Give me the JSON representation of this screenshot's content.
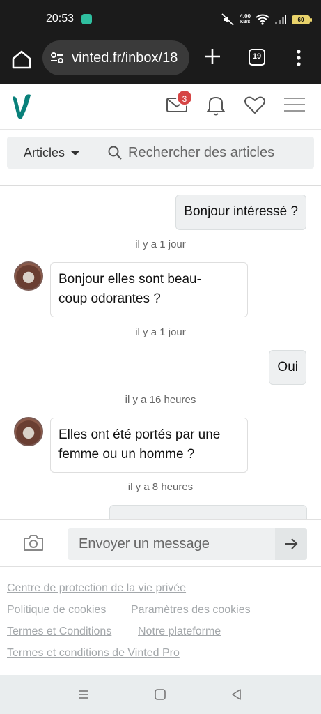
{
  "status_bar": {
    "time": "20:53",
    "net_speed_value": "4.00",
    "net_speed_unit": "KB/S",
    "battery": "60"
  },
  "browser": {
    "url": "vinted.fr/inbox/18",
    "tab_count": "19"
  },
  "header": {
    "unread_count": "3"
  },
  "search": {
    "category": "Articles",
    "placeholder": "Rechercher des articles"
  },
  "messages": [
    {
      "from": "me",
      "text": "Bonjour intéressé ?",
      "time": "il y a 1 jour"
    },
    {
      "from": "them",
      "text": "Bonjour elles sont beau-coup odorantes ?",
      "line1": "Bonjour elles sont beau-",
      "line2": "coup odorantes ?",
      "time": "il y a 1 jour"
    },
    {
      "from": "me",
      "text": "Oui",
      "time": "il y a 16 heures"
    },
    {
      "from": "them",
      "text": "Elles ont été portés par une femme ou un homme ?",
      "line1": "Elles ont été portés par une",
      "line2": "femme ou un homme ?",
      "time": "il y a 8 heures"
    }
  ],
  "composer": {
    "placeholder": "Envoyer un message"
  },
  "footer": {
    "privacy": "Centre de protection de la vie privée",
    "cookies": "Politique de cookies",
    "cookie_settings": "Paramètres des cookies",
    "terms": "Termes et Conditions",
    "platform": "Notre plateforme",
    "pro_terms": "Termes et conditions de Vinted Pro"
  },
  "colors": {
    "brand": "#09807a",
    "badge": "#d64545"
  }
}
